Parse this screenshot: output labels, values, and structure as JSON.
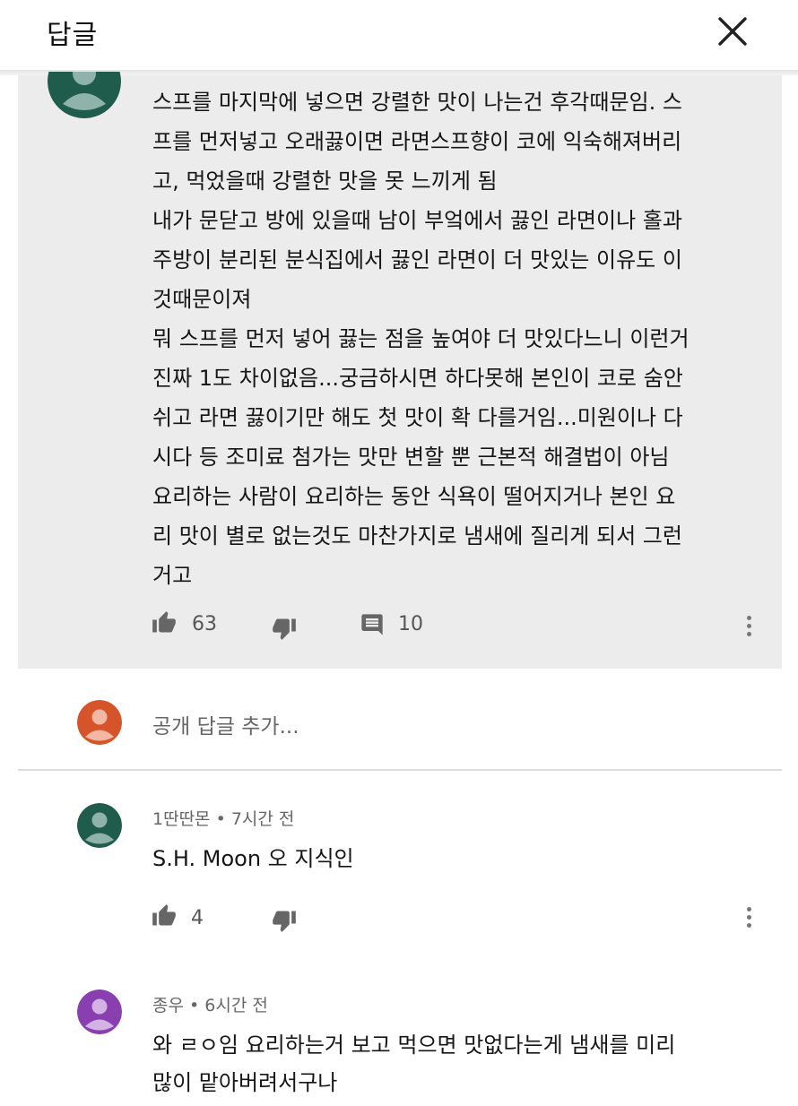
{
  "header": {
    "title": "답글"
  },
  "main_comment": {
    "lines": [
      "스프를 마지막에 넣으면 강렬한 맛이 나는건 후각때문임. 스",
      "프를 먼저넣고 오래끓이면 라면스프향이 코에 익숙해져버리",
      "고, 먹었을때 강렬한 맛을 못 느끼게 됨",
      "내가 문닫고 방에 있을때 남이 부엌에서 끓인 라면이나 홀과",
      "주방이 분리된 분식집에서 끓인 라면이 더 맛있는 이유도 이",
      "것때문이져",
      "뭐 스프를 먼저 넣어 끓는 점을 높여야 더 맛있다느니 이런거",
      "진짜 1도 차이없음...궁금하시면 하다못해 본인이 코로 숨안",
      "쉬고 라면 끓이기만 해도 첫 맛이 확 다를거임...미원이나 다",
      "시다 등 조미료 첨가는 맛만 변할 뿐 근본적 해결법이 아님",
      "요리하는 사람이 요리하는 동안 식욕이 떨어지거나 본인 요",
      "리 맛이 별로 없는것도 마찬가지로 냄새에 질리게 되서 그런",
      "거고"
    ],
    "likes": "63",
    "replies": "10"
  },
  "reply_input": {
    "placeholder": "공개 답글 추가..."
  },
  "replies": [
    {
      "author": "1딴딴몬",
      "time": "7시간 전",
      "lines": [
        "S.H. Moon 오 지식인"
      ],
      "likes": "4"
    },
    {
      "author": "종우",
      "time": "6시간 전",
      "lines": [
        "와 ㄹㅇ임 요리하는거 보고 먹으면 맛없다는게  냄새를 미리",
        "많이 맡아버려서구나"
      ]
    }
  ],
  "colors": {
    "avatar_main": "#1f5c4c",
    "avatar_user": "#d5542a",
    "avatar_reply1": "#1f5c4c",
    "avatar_reply2": "#8a3fb0",
    "highlight_bg": "#ececec"
  },
  "icons": [
    "close-icon",
    "thumb-up-icon",
    "thumb-down-icon",
    "comment-icon",
    "more-vert-icon",
    "avatar-icon"
  ]
}
